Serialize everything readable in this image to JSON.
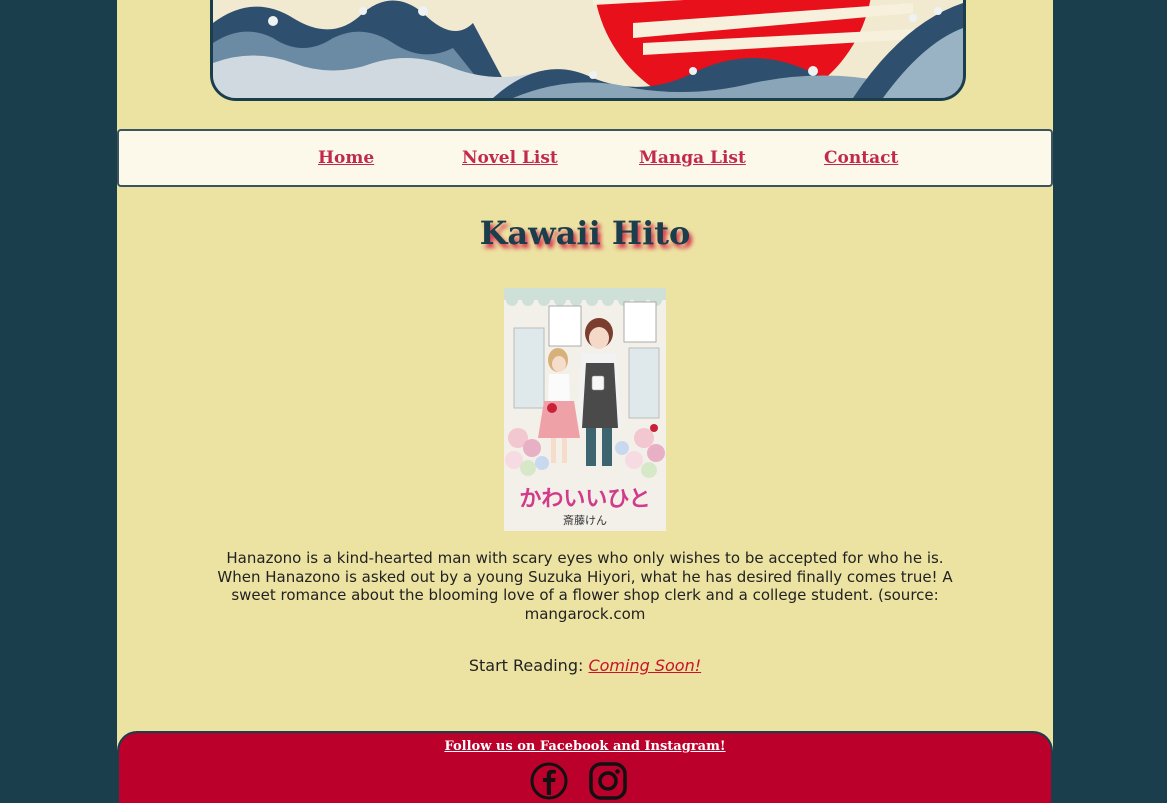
{
  "nav": {
    "items": [
      {
        "label": "Home"
      },
      {
        "label": "Novel List"
      },
      {
        "label": "Manga List"
      },
      {
        "label": "Contact"
      }
    ]
  },
  "main": {
    "title": "Kawaii Hito",
    "cover_text": {
      "title_jp": "かわいいひと",
      "author_jp": "斎藤けん"
    },
    "synopsis": "Hanazono is a kind-hearted man with scary eyes who only wishes to be accepted for who he is. When Hanazono is asked out by a young Suzuka Hiyori, what he has desired finally comes true! A sweet romance about the blooming love of a flower shop clerk and a college student. (source: mangarock.com",
    "start_reading_label": "Start Reading:",
    "start_reading_link": "Coming Soon!"
  },
  "footer": {
    "follow_text": "Follow us on Facebook and Instagram!",
    "icons": [
      "facebook-icon",
      "instagram-icon"
    ]
  },
  "colors": {
    "page_bg": "#1b3e4c",
    "content_bg": "#ece3a3",
    "nav_bg": "#fcf9eb",
    "link": "#c22a4b",
    "footer_bg": "#bb002b"
  }
}
